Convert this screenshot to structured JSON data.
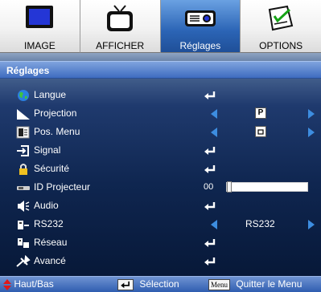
{
  "tabs": [
    {
      "label": "IMAGE",
      "icon": "monitor-icon",
      "active": false
    },
    {
      "label": "AFFICHER",
      "icon": "tv-icon",
      "active": false
    },
    {
      "label": "Réglages",
      "icon": "projector-icon",
      "active": true
    },
    {
      "label": "OPTIONS",
      "icon": "options-icon",
      "active": false
    }
  ],
  "section_title": "Réglages",
  "menu": [
    {
      "label": "Langue",
      "icon": "globe-icon",
      "control": "enter"
    },
    {
      "label": "Projection",
      "icon": "projection-icon",
      "control": "select-icon",
      "value_icon": "P"
    },
    {
      "label": "Pos. Menu",
      "icon": "menu-position-icon",
      "control": "select-icon",
      "value_icon": "▫"
    },
    {
      "label": "Signal",
      "icon": "signal-icon",
      "control": "enter"
    },
    {
      "label": "Sécurité",
      "icon": "lock-icon",
      "control": "enter"
    },
    {
      "label": "ID Projecteur",
      "icon": "projector-id-icon",
      "control": "slider",
      "value": "00",
      "level": 0
    },
    {
      "label": "Audio",
      "icon": "speaker-icon",
      "control": "enter"
    },
    {
      "label": "RS232",
      "icon": "rs232-icon",
      "control": "select",
      "value": "RS232"
    },
    {
      "label": "Réseau",
      "icon": "network-icon",
      "control": "enter"
    },
    {
      "label": "Avancé",
      "icon": "advanced-icon",
      "control": "enter"
    }
  ],
  "footer": {
    "nav_label": "Haut/Bas",
    "select_label": "Sélection",
    "menu_key": "Menu",
    "exit_label": "Quitter le Menu"
  },
  "colors": {
    "accent": "#2b64b5",
    "panel_top": "#1f3a6e",
    "panel_bottom": "#061634",
    "arrow_blue": "#3d8de0",
    "footer_arrow_red": "#e01818"
  }
}
